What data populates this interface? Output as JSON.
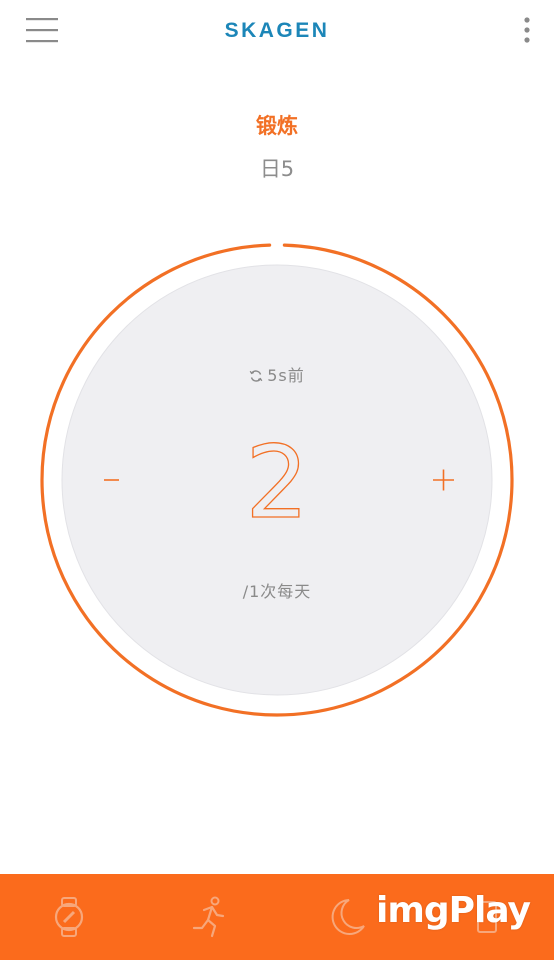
{
  "app": {
    "brand": "SKAGEN"
  },
  "header": {
    "title": "锻炼",
    "subtitle": "日5"
  },
  "tracker": {
    "sync_text": "5s前",
    "count": "2",
    "goal_text": "/1次每天",
    "progress": 0.99
  },
  "bottom_nav": {
    "items": [
      {
        "icon": "watch-icon"
      },
      {
        "icon": "running-icon"
      },
      {
        "icon": "moon-icon"
      },
      {
        "icon": "phone-icon"
      }
    ],
    "watermark": "imgPlay"
  },
  "colors": {
    "accent": "#f27025",
    "brand": "#1c86b8",
    "nav_bg": "#fb6b1c",
    "dial_bg": "#efeff2"
  }
}
